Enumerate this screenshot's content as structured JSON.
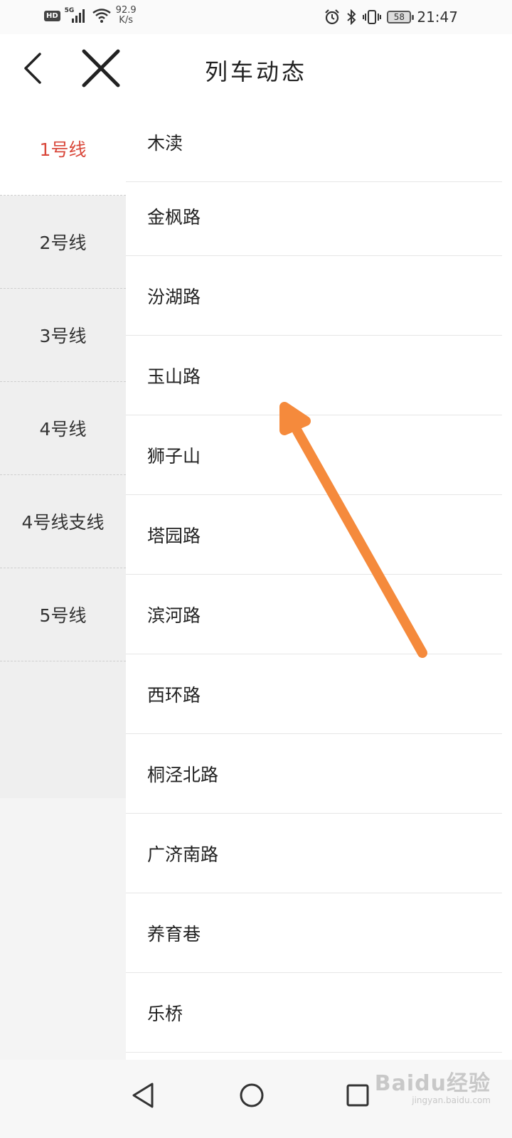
{
  "status_bar": {
    "hd": "HD",
    "network": "5G",
    "speed_value": "92.9",
    "speed_unit": "K/s",
    "battery": "58",
    "time": "21:47",
    "icons": [
      "alarm-icon",
      "bluetooth-icon",
      "vibrate-icon"
    ]
  },
  "header": {
    "title": "列车动态",
    "back_icon": "chevron-left-icon",
    "close_icon": "close-icon"
  },
  "lines": [
    {
      "label": "1号线",
      "active": true
    },
    {
      "label": "2号线",
      "active": false
    },
    {
      "label": "3号线",
      "active": false
    },
    {
      "label": "4号线",
      "active": false
    },
    {
      "label": "4号线支线",
      "active": false
    },
    {
      "label": "5号线",
      "active": false
    }
  ],
  "stations": [
    "木渎",
    "金枫路",
    "汾湖路",
    "玉山路",
    "狮子山",
    "塔园路",
    "滨河路",
    "西环路",
    "桐泾北路",
    "广济南路",
    "养育巷",
    "乐桥"
  ],
  "navbar": {
    "icons": [
      "back-triangle-icon",
      "home-circle-icon",
      "recents-square-icon"
    ]
  },
  "watermark": {
    "main": "Baidu经验",
    "sub": "jingyan.baidu.com"
  },
  "colors": {
    "active_line": "#d9473a",
    "annotation_arrow": "#f58a3c"
  }
}
